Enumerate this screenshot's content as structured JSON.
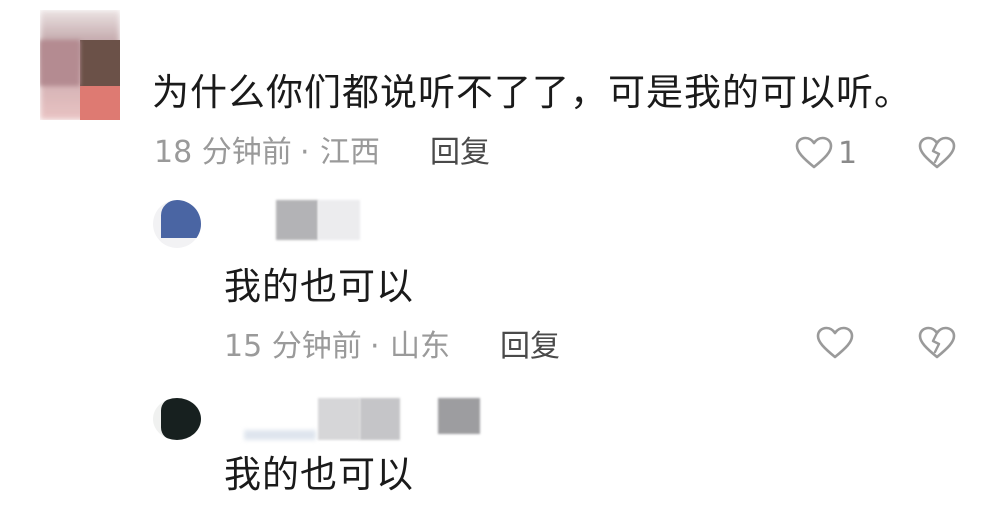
{
  "comments": [
    {
      "text": "为什么你们都说听不了了，可是我的可以听。",
      "time": "18 分钟前",
      "separator": "·",
      "location": "江西",
      "reply_label": "回复",
      "like_count": "1"
    },
    {
      "text": "我的也可以",
      "time": "15 分钟前",
      "separator": "·",
      "location": "山东",
      "reply_label": "回复"
    },
    {
      "text": "我的也可以"
    }
  ],
  "icons": {
    "like": "heart-outline-icon",
    "dislike": "broken-heart-icon"
  },
  "colors": {
    "text": "#1a1a1a",
    "meta": "#9a9a9a",
    "icon": "#9a9a9a",
    "background": "#ffffff"
  }
}
